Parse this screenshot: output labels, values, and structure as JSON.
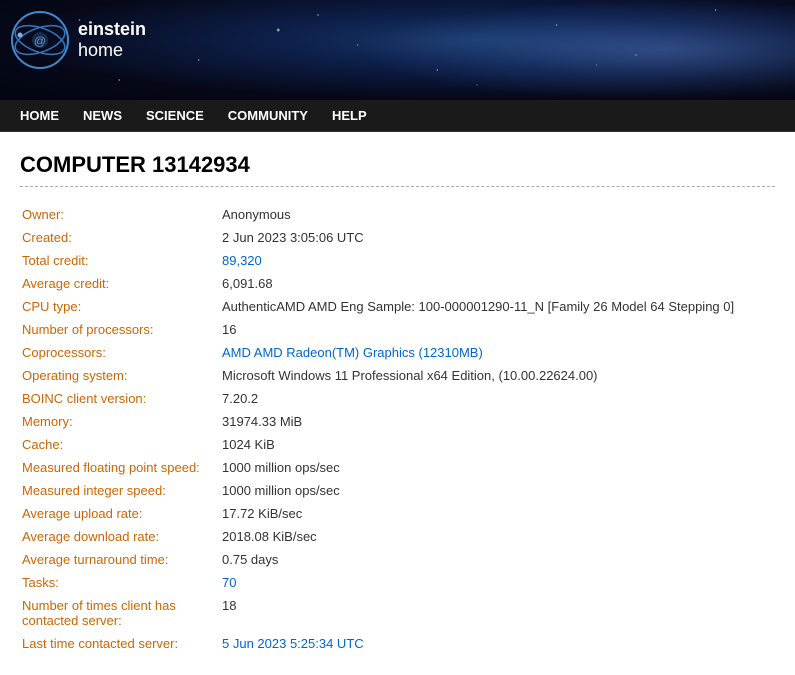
{
  "header": {
    "logo_line1": "einstein",
    "logo_line2": "home"
  },
  "nav": {
    "items": [
      {
        "label": "HOME",
        "id": "home"
      },
      {
        "label": "NEWS",
        "id": "news"
      },
      {
        "label": "SCIENCE",
        "id": "science"
      },
      {
        "label": "COMMUNITY",
        "id": "community"
      },
      {
        "label": "HELP",
        "id": "help"
      }
    ]
  },
  "page": {
    "title": "COMPUTER 13142934",
    "fields": [
      {
        "label": "Owner:",
        "value": "Anonymous",
        "type": "text"
      },
      {
        "label": "Created:",
        "value": "2 Jun 2023 3:05:06 UTC",
        "type": "text"
      },
      {
        "label": "Total credit:",
        "value": "89,320",
        "type": "link"
      },
      {
        "label": "Average credit:",
        "value": "6,091.68",
        "type": "text"
      },
      {
        "label": "CPU type:",
        "value": "AuthenticAMD AMD Eng Sample: 100-000001290-11_N [Family 26 Model 64 Stepping 0]",
        "type": "text"
      },
      {
        "label": "Number of processors:",
        "value": "16",
        "type": "text"
      },
      {
        "label": "Coprocessors:",
        "value": "AMD AMD Radeon(TM) Graphics (12310MB)",
        "type": "link"
      },
      {
        "label": "Operating system:",
        "value": "Microsoft Windows 11 Professional x64 Edition, (10.00.22624.00)",
        "type": "text"
      },
      {
        "label": "BOINC client version:",
        "value": "7.20.2",
        "type": "text"
      },
      {
        "label": "Memory:",
        "value": "31974.33 MiB",
        "type": "text"
      },
      {
        "label": "Cache:",
        "value": "1024 KiB",
        "type": "text"
      },
      {
        "label": "Measured floating point speed:",
        "value": "1000 million ops/sec",
        "type": "text"
      },
      {
        "label": "Measured integer speed:",
        "value": "1000 million ops/sec",
        "type": "text"
      },
      {
        "label": "Average upload rate:",
        "value": "17.72 KiB/sec",
        "type": "text"
      },
      {
        "label": "Average download rate:",
        "value": "2018.08 KiB/sec",
        "type": "text"
      },
      {
        "label": "Average turnaround time:",
        "value": "0.75 days",
        "type": "text"
      },
      {
        "label": "Tasks:",
        "value": "70",
        "type": "link"
      },
      {
        "label": "Number of times client has contacted server:",
        "value": "18",
        "type": "text"
      },
      {
        "label": "Last time contacted server:",
        "value": "5 Jun 2023 5:25:34 UTC",
        "type": "link"
      }
    ]
  }
}
